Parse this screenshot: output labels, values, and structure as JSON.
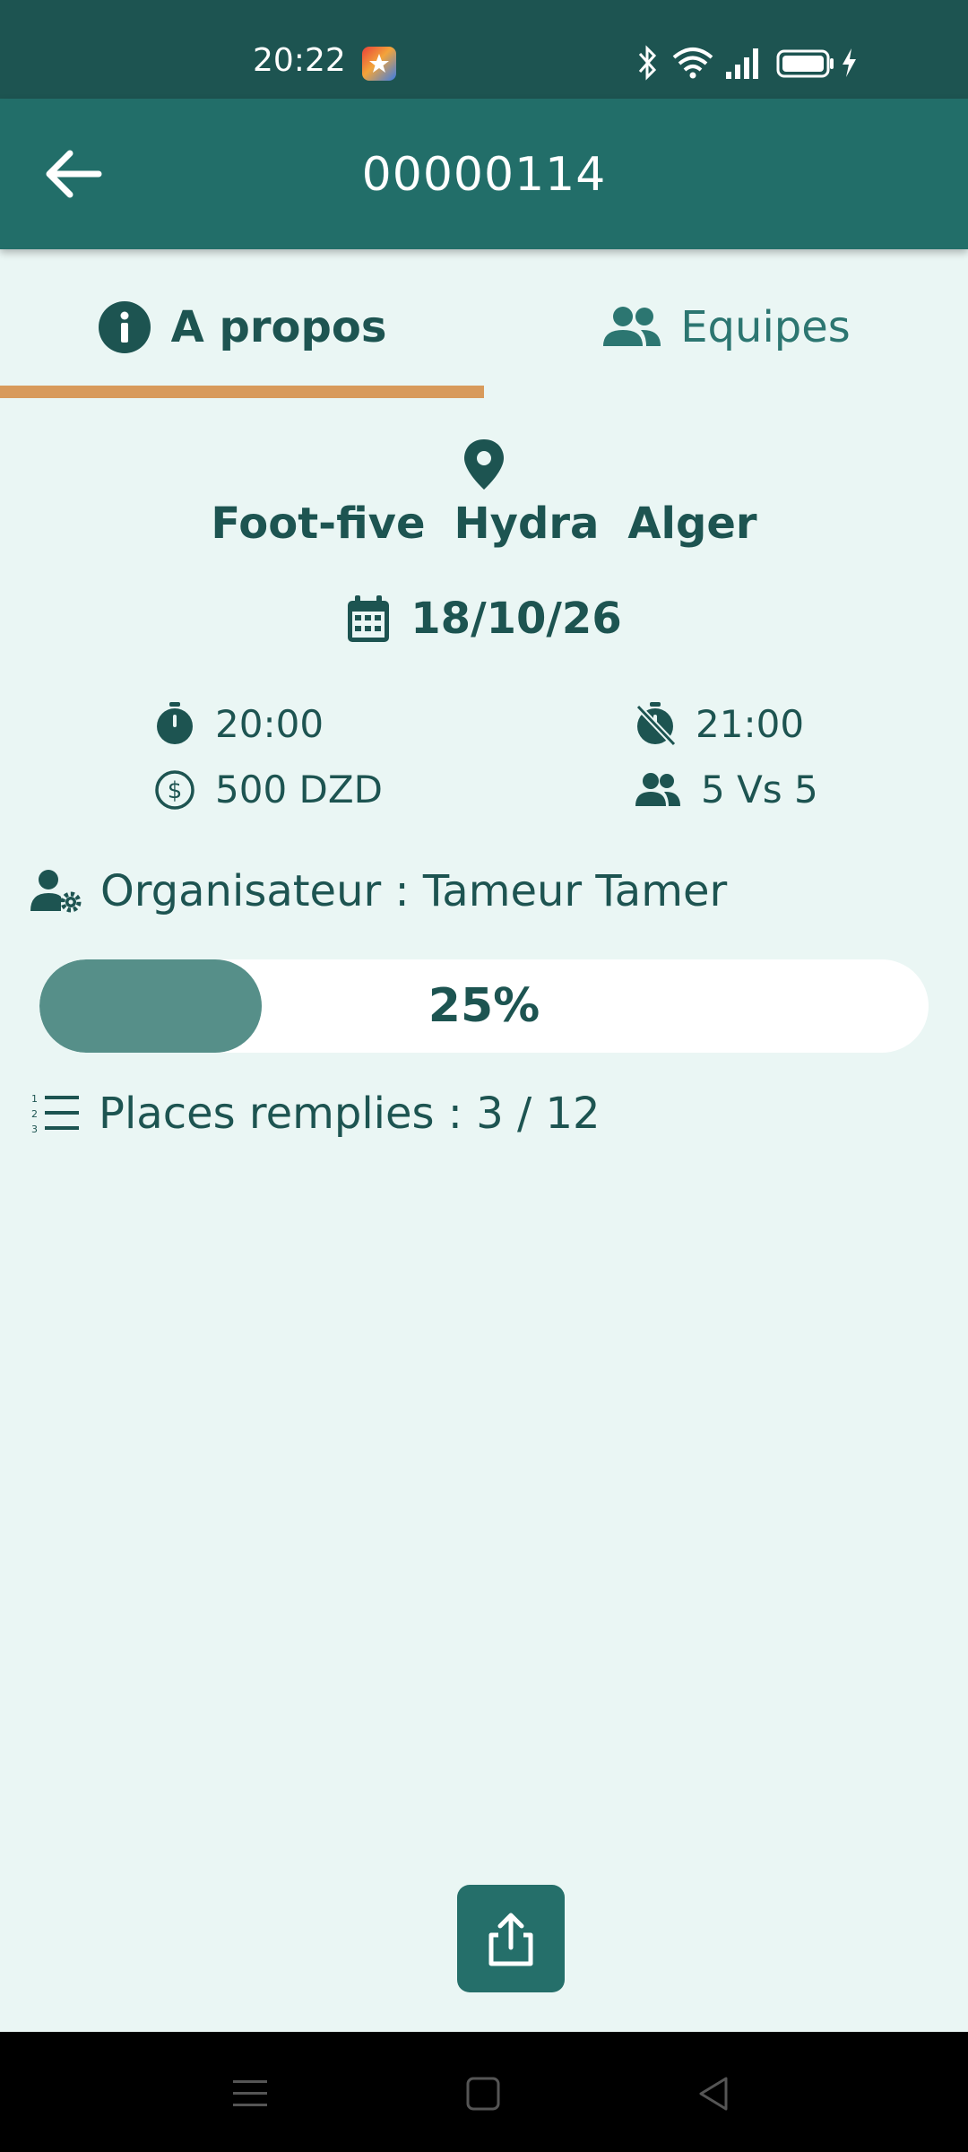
{
  "status_bar": {
    "time": "20:22",
    "icons": [
      "notification-app-icon",
      "bluetooth-icon",
      "wifi-icon",
      "signal-icon",
      "battery-icon",
      "charging-icon"
    ]
  },
  "app_bar": {
    "title": "00000114",
    "back_icon": "arrow-left-icon"
  },
  "tabs": [
    {
      "label": "A propos",
      "icon": "info-icon",
      "selected": true
    },
    {
      "label": "Equipes",
      "icon": "people-icon",
      "selected": false
    }
  ],
  "colors": {
    "status_bar": "#1d5451",
    "app_bar": "#226e69",
    "background": "#eaf6f4",
    "tab_indicator": "#d89a5b",
    "progress_fill": "#568f89",
    "text": "#1d5451"
  },
  "match": {
    "location": {
      "type": "Foot-five",
      "district": "Hydra",
      "city": "Alger"
    },
    "date": "18/10/26",
    "start_time": "20:00",
    "end_time": "21:00",
    "price": "500 DZD",
    "format": "5 Vs 5",
    "organizer_label": "Organisateur : Tameur Tamer",
    "progress": {
      "percent": 25,
      "label": "25%"
    },
    "places_label": "Places remplies : 3 / 12"
  },
  "share_button": {
    "icon": "share-icon"
  },
  "nav_bar": {
    "buttons": [
      "menu-icon",
      "home-icon",
      "back-triangle-icon"
    ]
  }
}
